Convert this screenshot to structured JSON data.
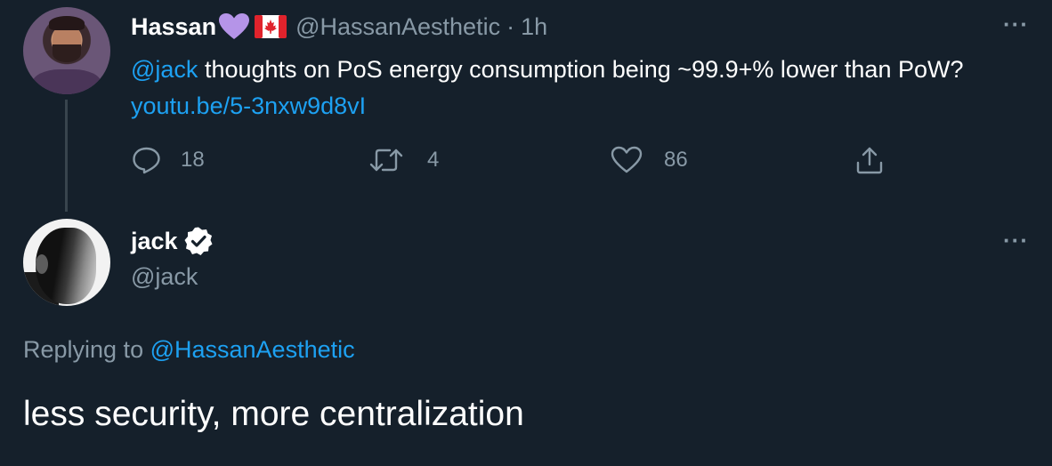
{
  "tweet": {
    "author_name": "Hassan",
    "handle": "@HassanAesthetic",
    "separator": "·",
    "time": "1h",
    "mention": "@jack",
    "text": " thoughts on PoS energy consumption being ~99.9+% lower than PoW? ",
    "link": "youtu.be/5-3nxw9d8vI",
    "reply_count": "18",
    "retweet_count": "4",
    "like_count": "86",
    "more_label": "···"
  },
  "reply": {
    "author_name": "jack",
    "handle": "@jack",
    "more_label": "···",
    "replying_prefix": "Replying to ",
    "replying_to": "@HassanAesthetic",
    "text": "less security, more centralization"
  },
  "icons": {
    "heart_emoji": "purple-heart-icon",
    "flag": "canada-flag-icon",
    "verified": "verified-badge-icon",
    "reply": "reply-icon",
    "retweet": "retweet-icon",
    "like": "like-icon",
    "share": "share-icon"
  },
  "colors": {
    "background": "#15202b",
    "accent": "#1da1f2",
    "secondary_text": "#8899a6",
    "heart": "#b594e8",
    "flag_red": "#e0232c"
  }
}
